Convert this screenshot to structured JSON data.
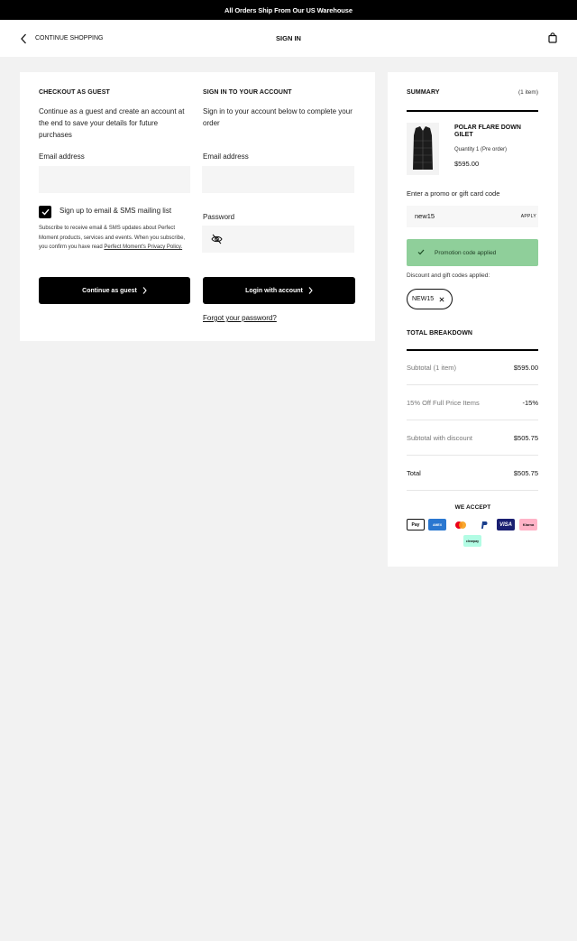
{
  "announcement": "All Orders Ship From Our US Warehouse",
  "nav": {
    "back_label": "CONTINUE SHOPPING",
    "title": "SIGN IN"
  },
  "guest": {
    "title": "CHECKOUT AS GUEST",
    "description": "Continue as a guest and create an account at the end to save your details for future purchases",
    "email_label": "Email address",
    "email_value": "",
    "signup_label": "Sign up to email & SMS mailing list",
    "signup_checked": true,
    "signup_small_text": "Subscribe to receive email & SMS updates about Perfect Moment products, services and events. When you subscribe, you confirm you have read",
    "privacy_link": "Perfect Moment's Privacy Policy.",
    "continue_label": "Continue as guest"
  },
  "signin": {
    "title": "SIGN IN TO YOUR ACCOUNT",
    "description": "Sign in to your account below to complete your order",
    "email_label": "Email address",
    "email_value": "",
    "password_label": "Password",
    "password_value": "",
    "login_label": "Login with account",
    "forgot_label": "Forgot your password?"
  },
  "summary": {
    "title": "SUMMARY",
    "count": "(1 item)",
    "item": {
      "name": "POLAR FLARE DOWN GILET",
      "quantity": "Quantity 1 (Pre order)",
      "price": "$595.00"
    },
    "promo_label": "Enter a promo or gift card code",
    "promo_value": "new15",
    "apply_label": "APPLY",
    "promo_success": "Promotion code applied",
    "applied_label": "Discount and gift codes applied:",
    "applied_code": "NEW15",
    "breakdown_title": "TOTAL BREAKDOWN",
    "rows": [
      {
        "label": "Subtotal (1 item)",
        "value": "$595.00"
      },
      {
        "label": "15% Off Full Price Items",
        "value": "-15%"
      },
      {
        "label": "Subtotal with discount",
        "value": "$505.75"
      },
      {
        "label": "Total",
        "value": "$505.75"
      }
    ],
    "accept_title": "WE ACCEPT",
    "payments": {
      "applepay": "Pay",
      "amex": "AMEX",
      "visa": "VISA",
      "klarna": "Klarna",
      "clearpay": "clearpay"
    }
  },
  "colors": {
    "promo_success_bg": "#8fcf9a",
    "page_bg": "#f2f2f2"
  }
}
